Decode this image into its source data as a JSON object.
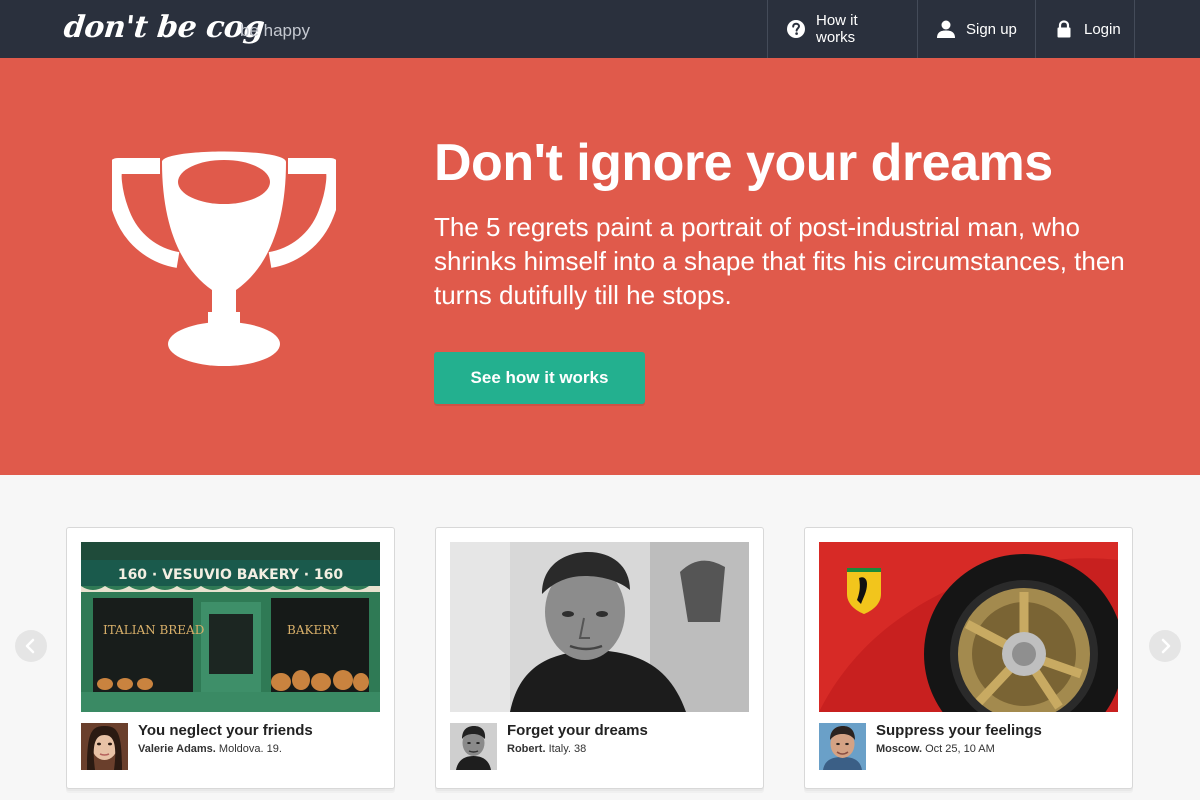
{
  "nav": {
    "logo": "don't be cog",
    "tagline": "be happy",
    "items": [
      {
        "label": "How it works",
        "icon": "question-icon"
      },
      {
        "label": "Sign up",
        "icon": "user-icon"
      },
      {
        "label": "Login",
        "icon": "lock-icon"
      }
    ]
  },
  "hero": {
    "title": "Don't ignore your dreams",
    "text": "The 5 regrets paint a portrait of post-industrial man, who shrinks himself into a shape that fits his circumstances, then turns dutifully till he stops.",
    "button": "See how it works",
    "icon": "trophy-icon"
  },
  "cards": [
    {
      "title": "You neglect your friends",
      "author": "Valerie Adams.",
      "details": "Moldova. 19.",
      "sign": "160 · VESUVIO BAKERY · 160"
    },
    {
      "title": "Forget your dreams",
      "author": "Robert.",
      "details": "Italy. 38"
    },
    {
      "title": "Suppress your feelings",
      "author": "Moscow.",
      "details": "Oct 25, 10 AM"
    }
  ],
  "colors": {
    "navbar": "#2a303d",
    "hero": "#e05a4b",
    "button": "#23b08f"
  }
}
